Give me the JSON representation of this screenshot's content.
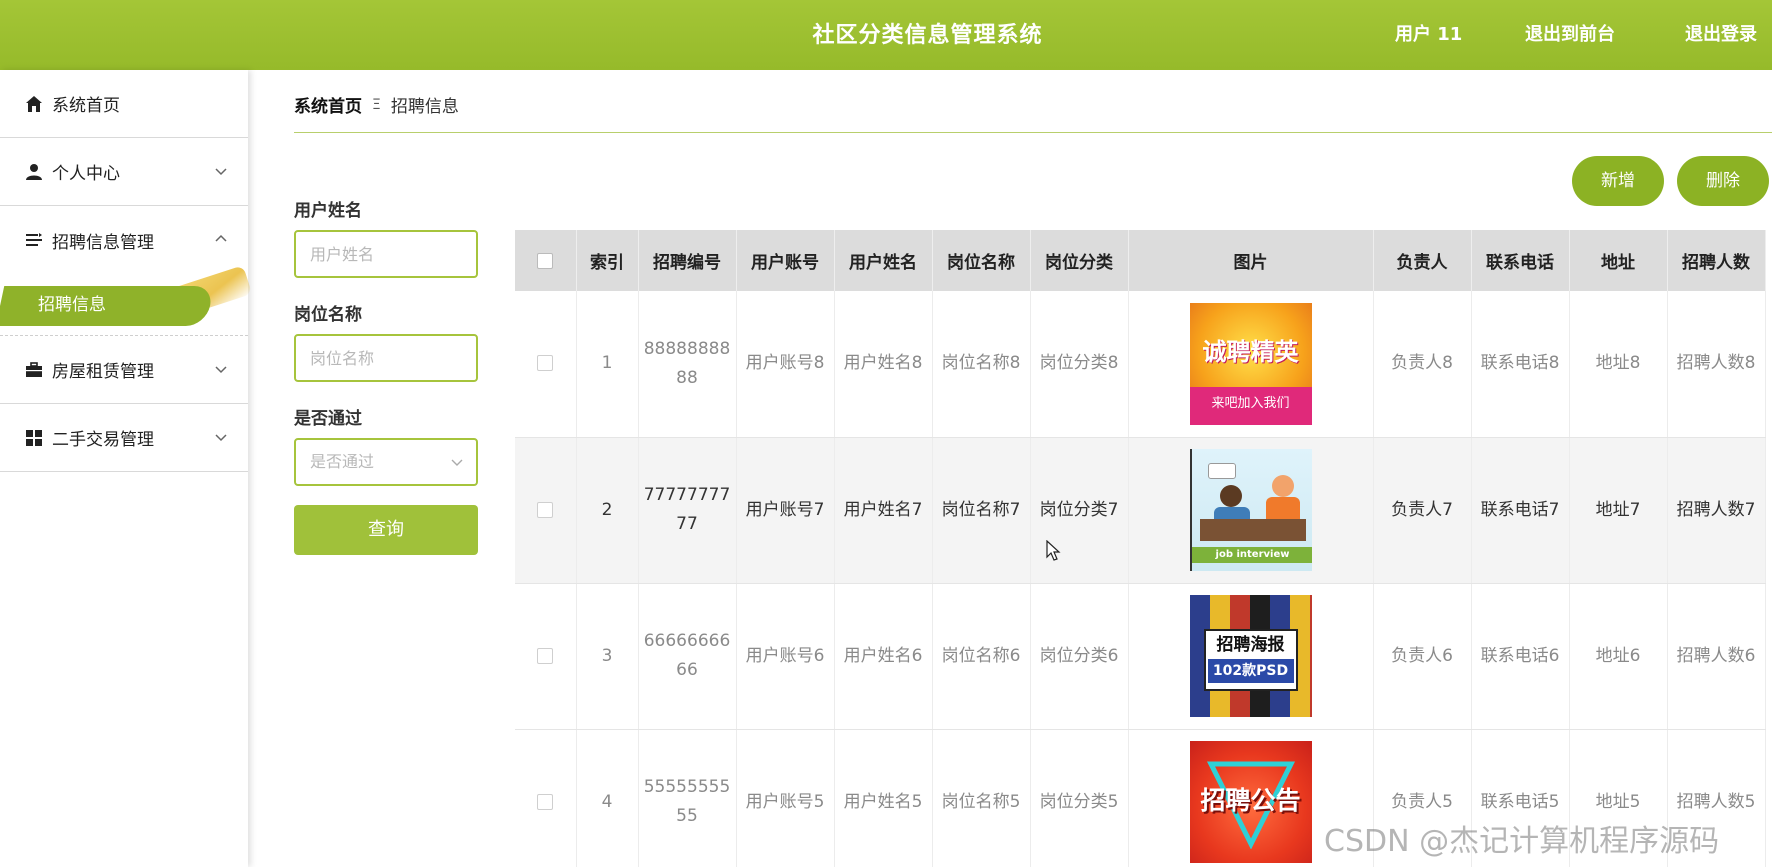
{
  "header": {
    "title": "社区分类信息管理系统",
    "user": "用户 11",
    "back_to_front": "退出到前台",
    "logout": "退出登录"
  },
  "sidebar": {
    "items": [
      {
        "label": "系统首页",
        "icon": "home-icon"
      },
      {
        "label": "个人中心",
        "icon": "user-icon"
      },
      {
        "label": "招聘信息管理",
        "icon": "list-icon"
      },
      {
        "label": "房屋租赁管理",
        "icon": "briefcase-icon"
      },
      {
        "label": "二手交易管理",
        "icon": "grid-icon"
      }
    ],
    "active_sub": "招聘信息"
  },
  "breadcrumb": {
    "home": "系统首页",
    "separator": "Ξ",
    "current": "招聘信息"
  },
  "filters": {
    "name_label": "用户姓名",
    "name_placeholder": "用户姓名",
    "job_label": "岗位名称",
    "job_placeholder": "岗位名称",
    "pass_label": "是否通过",
    "pass_placeholder": "是否通过",
    "query": "查询"
  },
  "actions": {
    "add": "新增",
    "delete": "删除"
  },
  "table": {
    "headers": [
      "索引",
      "招聘编号",
      "用户账号",
      "用户姓名",
      "岗位名称",
      "岗位分类",
      "图片",
      "负责人",
      "联系电话",
      "地址",
      "招聘人数"
    ],
    "rows": [
      {
        "idx": "1",
        "code": "8888888888",
        "account": "用户账号8",
        "name": "用户姓名8",
        "job": "岗位名称8",
        "category": "岗位分类8",
        "img_text": "诚聘精英",
        "img_sub": "来吧加入我们",
        "manager": "负责人8",
        "phone": "联系电话8",
        "addr": "地址8",
        "count": "招聘人数8"
      },
      {
        "idx": "2",
        "code": "7777777777",
        "account": "用户账号7",
        "name": "用户姓名7",
        "job": "岗位名称7",
        "category": "岗位分类7",
        "img_text": "job interview",
        "img_sub": "",
        "manager": "负责人7",
        "phone": "联系电话7",
        "addr": "地址7",
        "count": "招聘人数7"
      },
      {
        "idx": "3",
        "code": "6666666666",
        "account": "用户账号6",
        "name": "用户姓名6",
        "job": "岗位名称6",
        "category": "岗位分类6",
        "img_text": "招聘海报",
        "img_sub": "102款PSD",
        "manager": "负责人6",
        "phone": "联系电话6",
        "addr": "地址6",
        "count": "招聘人数6"
      },
      {
        "idx": "4",
        "code": "5555555555",
        "account": "用户账号5",
        "name": "用户姓名5",
        "job": "岗位名称5",
        "category": "岗位分类5",
        "img_text": "招聘公告",
        "img_sub": "",
        "manager": "负责人5",
        "phone": "联系电话5",
        "addr": "地址5",
        "count": "招聘人数5"
      }
    ]
  },
  "watermark": "CSDN @杰记计算机程序源码",
  "colors": {
    "primary": "#9abe31",
    "button": "#8cb224",
    "header_bg": "#dcdcdc"
  }
}
